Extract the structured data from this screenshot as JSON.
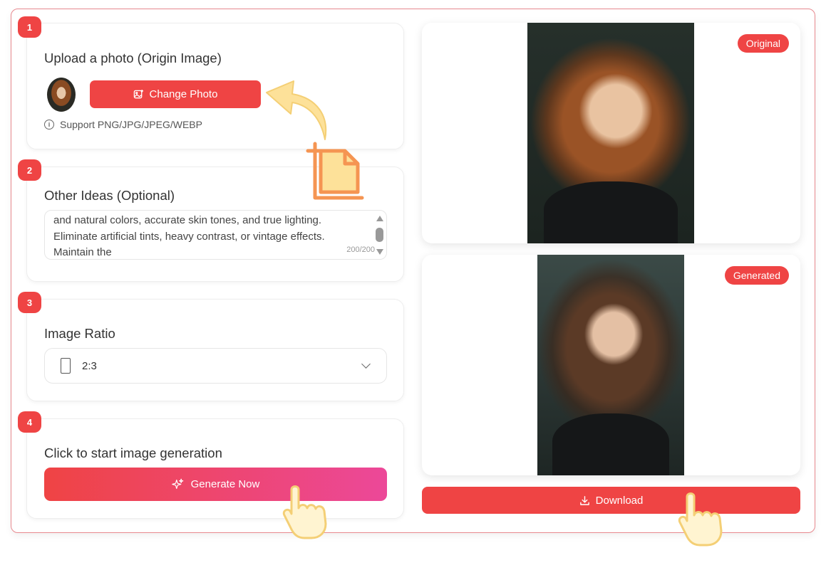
{
  "steps": [
    {
      "number": "1",
      "title": "Upload a photo (Origin Image)"
    },
    {
      "number": "2",
      "title": "Other Ideas (Optional)"
    },
    {
      "number": "3",
      "title": "Image Ratio"
    },
    {
      "number": "4",
      "title": "Click to start image generation"
    }
  ],
  "upload": {
    "button_label": "Change Photo",
    "support_text": "Support PNG/JPG/JPEG/WEBP"
  },
  "ideas": {
    "text": "and natural colors, accurate skin tones, and true lighting. Eliminate artificial tints, heavy contrast, or vintage effects. Maintain the",
    "counter": "200/200"
  },
  "ratio": {
    "selected": "2:3"
  },
  "generate": {
    "button_label": "Generate Now"
  },
  "preview": {
    "original_tag": "Original",
    "generated_tag": "Generated",
    "download_label": "Download"
  },
  "colors": {
    "accent": "#ef4444",
    "gradient_end": "#ec4899",
    "pointer": "#fde199",
    "crop_icon": "#f59552"
  }
}
